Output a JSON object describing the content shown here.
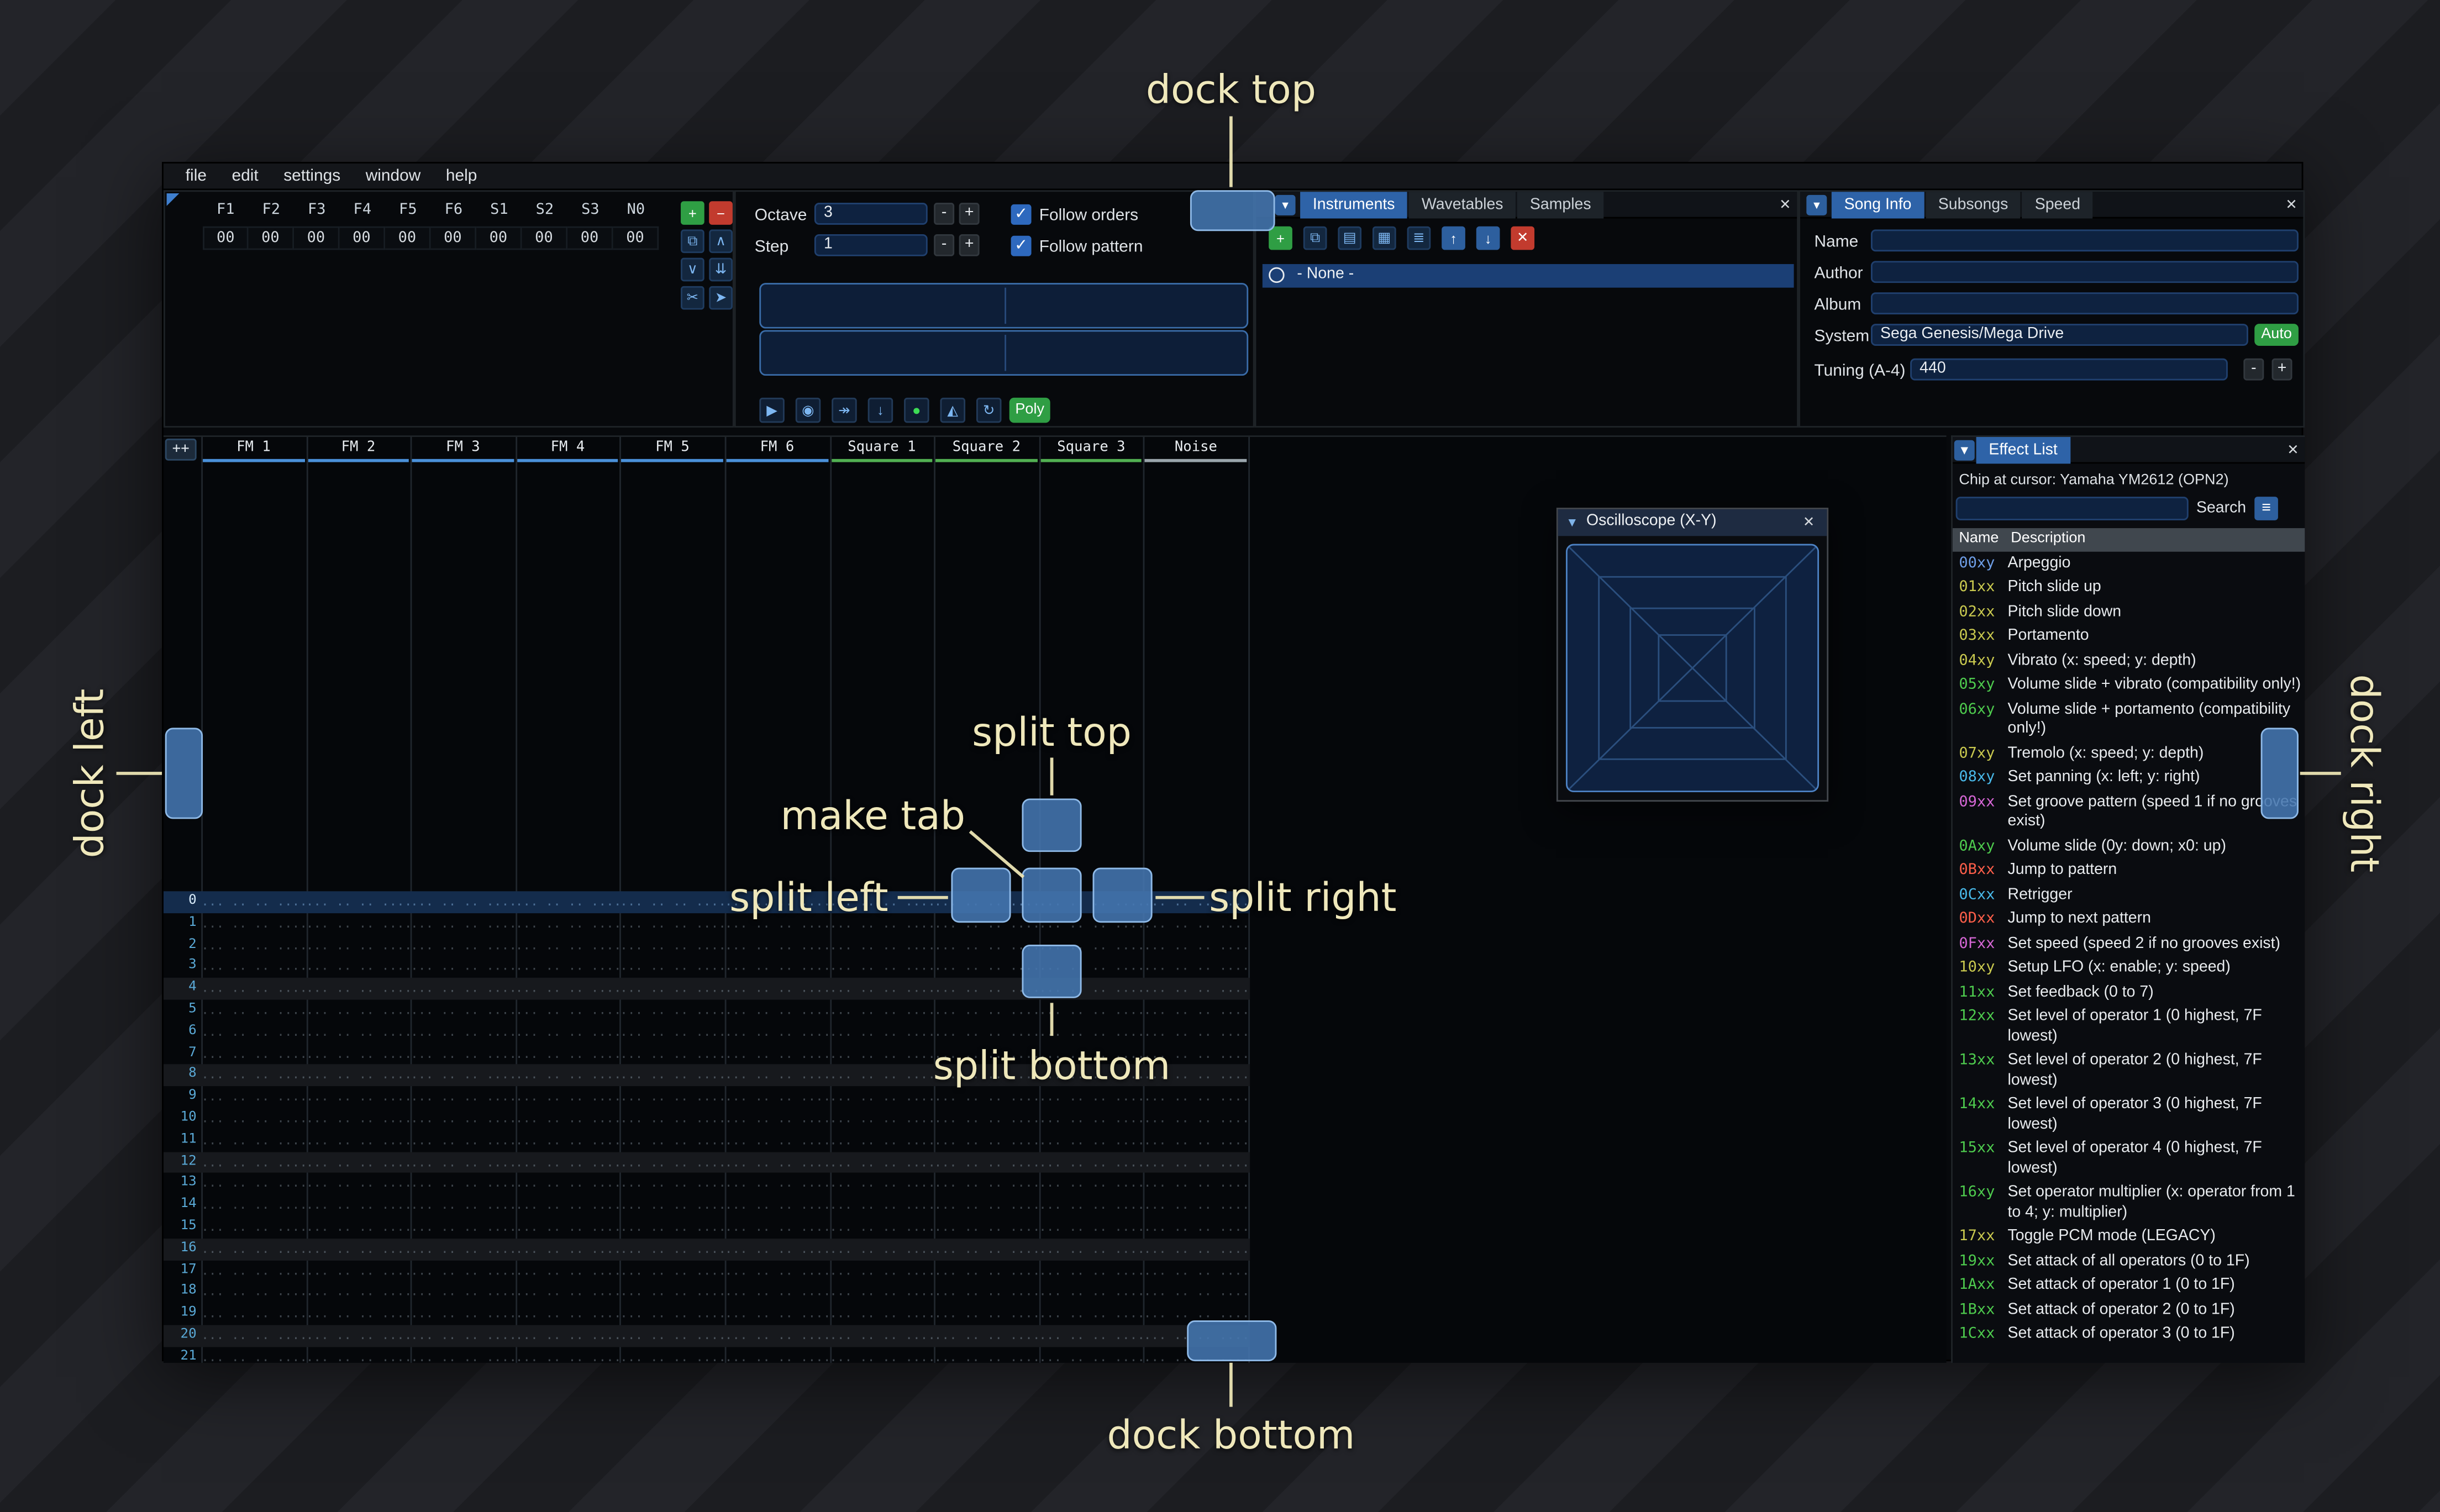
{
  "app": {
    "menu": [
      "file",
      "edit",
      "settings",
      "window",
      "help"
    ]
  },
  "monitor": {
    "labels": [
      "F1",
      "F2",
      "F3",
      "F4",
      "F5",
      "F6",
      "S1",
      "S2",
      "S3",
      "N0"
    ],
    "values": [
      "00",
      "00",
      "00",
      "00",
      "00",
      "00",
      "00",
      "00",
      "00",
      "00"
    ]
  },
  "edit_cluster": [
    {
      "name": "add",
      "glyph": "+",
      "style": "green"
    },
    {
      "name": "remove",
      "glyph": "−",
      "style": "red"
    },
    {
      "name": "duplicate",
      "glyph": "⧉",
      "style": "icon"
    },
    {
      "name": "move-up",
      "glyph": "∧",
      "style": "icon"
    },
    {
      "name": "move-down",
      "glyph": "∨",
      "style": "icon"
    },
    {
      "name": "page-down",
      "glyph": "⇊",
      "style": "icon"
    },
    {
      "name": "cut",
      "glyph": "✂",
      "style": "icon"
    },
    {
      "name": "pointer",
      "glyph": "➤",
      "style": "icon"
    }
  ],
  "transport": {
    "octave_label": "Octave",
    "octave_value": "3",
    "step_label": "Step",
    "step_value": "1",
    "minus_label": "-",
    "plus_label": "+",
    "check_glyph": "✓",
    "follow_orders": "Follow orders",
    "follow_pattern": "Follow pattern",
    "playback": [
      {
        "name": "play",
        "glyph": "▶"
      },
      {
        "name": "stop",
        "glyph": "◉"
      },
      {
        "name": "play-pattern",
        "glyph": "↠"
      },
      {
        "name": "step-row",
        "glyph": "↓"
      },
      {
        "name": "record",
        "glyph": "●",
        "style": "record"
      },
      {
        "name": "metronome",
        "glyph": "◭"
      },
      {
        "name": "repeat",
        "glyph": "↻"
      }
    ],
    "poly_label": "Poly"
  },
  "assets": {
    "tab_list_glyph": "▾",
    "tabs": [
      "Instruments",
      "Wavetables",
      "Samples"
    ],
    "active_tab": "Instruments",
    "close_glyph": "✕",
    "toolbar": [
      {
        "name": "add",
        "glyph": "+",
        "style": "green"
      },
      {
        "name": "duplicate",
        "glyph": "⧉",
        "style": "icon"
      },
      {
        "name": "open",
        "glyph": "▤",
        "style": "icon"
      },
      {
        "name": "save",
        "glyph": "▦",
        "style": "icon"
      },
      {
        "name": "organize",
        "glyph": "≣",
        "style": "icon"
      },
      {
        "name": "move-up",
        "glyph": "↑",
        "style": "solid"
      },
      {
        "name": "move-down",
        "glyph": "↓",
        "style": "solid"
      },
      {
        "name": "delete",
        "glyph": "✕",
        "style": "red"
      }
    ],
    "none_item": "- None -"
  },
  "song": {
    "tab_list_glyph": "▾",
    "tabs": [
      "Song Info",
      "Subsongs",
      "Speed"
    ],
    "active_tab": "Song Info",
    "close_glyph": "✕",
    "fields": [
      {
        "label": "Name",
        "value": ""
      },
      {
        "label": "Author",
        "value": ""
      },
      {
        "label": "Album",
        "value": ""
      }
    ],
    "system_label": "System",
    "system_value": "Sega Genesis/Mega Drive",
    "auto_label": "Auto",
    "tuning_label": "Tuning (A-4)",
    "tuning_value": "440"
  },
  "pattern": {
    "corner_button": "++",
    "channels": [
      {
        "name": "FM 1",
        "color": "#4a90d9"
      },
      {
        "name": "FM 2",
        "color": "#4a90d9"
      },
      {
        "name": "FM 3",
        "color": "#4a90d9"
      },
      {
        "name": "FM 4",
        "color": "#4a90d9"
      },
      {
        "name": "FM 5",
        "color": "#4a90d9"
      },
      {
        "name": "FM 6",
        "color": "#4a90d9"
      },
      {
        "name": "Square 1",
        "color": "#52b052"
      },
      {
        "name": "Square 2",
        "color": "#52b052"
      },
      {
        "name": "Square 3",
        "color": "#52b052"
      },
      {
        "name": "Noise",
        "color": "#9aa5ac"
      }
    ],
    "row_numbers": [
      "0",
      "1",
      "2",
      "3",
      "4",
      "5",
      "6",
      "7",
      "8",
      "9",
      "10",
      "11",
      "12",
      "13",
      "14",
      "15",
      "16",
      "17",
      "18",
      "19",
      "20",
      "21"
    ],
    "empty_cell": "... .. .. ...."
  },
  "oscilloscope": {
    "collapse_glyph": "▼",
    "title": "Oscilloscope (X-Y)",
    "close_glyph": "✕"
  },
  "effects": {
    "collapse_glyph": "▼",
    "title": "Effect List",
    "close_glyph": "✕",
    "chip_line": "Chip at cursor: Yamaha YM2612 (OPN2)",
    "search_value": "",
    "search_label": "Search",
    "menu_glyph": "≡",
    "col_name": "Name",
    "col_desc": "Description",
    "rows": [
      {
        "code": "00xy",
        "color": "#6f9fe8",
        "desc": "Arpeggio"
      },
      {
        "code": "01xx",
        "color": "#c9c94f",
        "desc": "Pitch slide up"
      },
      {
        "code": "02xx",
        "color": "#c9c94f",
        "desc": "Pitch slide down"
      },
      {
        "code": "03xx",
        "color": "#c9c94f",
        "desc": "Portamento"
      },
      {
        "code": "04xy",
        "color": "#c9c94f",
        "desc": "Vibrato (x: speed; y: depth)"
      },
      {
        "code": "05xy",
        "color": "#4ecb4e",
        "desc": "Volume slide + vibrato (compatibility only!)"
      },
      {
        "code": "06xy",
        "color": "#4ecb4e",
        "desc": "Volume slide + portamento (compatibility only!)"
      },
      {
        "code": "07xy",
        "color": "#c9c94f",
        "desc": "Tremolo (x: speed; y: depth)"
      },
      {
        "code": "08xy",
        "color": "#49b9e9",
        "desc": "Set panning (x: left; y: right)"
      },
      {
        "code": "09xx",
        "color": "#d667d6",
        "desc": "Set groove pattern (speed 1 if no grooves exist)"
      },
      {
        "code": "0Axy",
        "color": "#4ecb4e",
        "desc": "Volume slide (0y: down; x0: up)"
      },
      {
        "code": "0Bxx",
        "color": "#ff5f4a",
        "desc": "Jump to pattern"
      },
      {
        "code": "0Cxx",
        "color": "#49b9e9",
        "desc": "Retrigger"
      },
      {
        "code": "0Dxx",
        "color": "#ff5f4a",
        "desc": "Jump to next pattern"
      },
      {
        "code": "0Fxx",
        "color": "#d667d6",
        "desc": "Set speed (speed 2 if no grooves exist)"
      },
      {
        "code": "10xy",
        "color": "#c9c94f",
        "desc": "Setup LFO (x: enable; y: speed)"
      },
      {
        "code": "11xx",
        "color": "#4ecb4e",
        "desc": "Set feedback (0 to 7)"
      },
      {
        "code": "12xx",
        "color": "#4ecb4e",
        "desc": "Set level of operator 1 (0 highest, 7F lowest)"
      },
      {
        "code": "13xx",
        "color": "#4ecb4e",
        "desc": "Set level of operator 2 (0 highest, 7F lowest)"
      },
      {
        "code": "14xx",
        "color": "#4ecb4e",
        "desc": "Set level of operator 3 (0 highest, 7F lowest)"
      },
      {
        "code": "15xx",
        "color": "#4ecb4e",
        "desc": "Set level of operator 4 (0 highest, 7F lowest)"
      },
      {
        "code": "16xy",
        "color": "#4ecb4e",
        "desc": "Set operator multiplier (x: operator from 1 to 4; y: multiplier)"
      },
      {
        "code": "17xx",
        "color": "#c9c94f",
        "desc": "Toggle PCM mode (LEGACY)"
      },
      {
        "code": "19xx",
        "color": "#4ecb4e",
        "desc": "Set attack of all operators (0 to 1F)"
      },
      {
        "code": "1Axx",
        "color": "#4ecb4e",
        "desc": "Set attack of operator 1 (0 to 1F)"
      },
      {
        "code": "1Bxx",
        "color": "#4ecb4e",
        "desc": "Set attack of operator 2 (0 to 1F)"
      },
      {
        "code": "1Cxx",
        "color": "#4ecb4e",
        "desc": "Set attack of operator 3 (0 to 1F)"
      }
    ]
  },
  "dock": {
    "labels": {
      "top": "dock top",
      "left": "dock left",
      "right": "dock right",
      "bottom": "dock bottom",
      "split_top": "split top",
      "split_left": "split left",
      "split_right": "split right",
      "split_bottom": "split bottom",
      "make_tab": "make tab"
    }
  }
}
